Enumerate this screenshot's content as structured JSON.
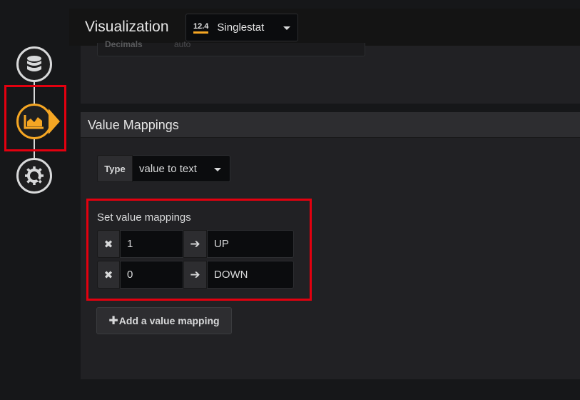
{
  "header": {
    "title": "Visualization",
    "picker_icon_text": "12.4",
    "picker_label": "Singlestat"
  },
  "steps": {
    "datasource_icon": "database-icon",
    "visualization_icon": "chart-area-icon",
    "general_icon": "gear-tools-icon"
  },
  "top_panel": {
    "field_label": "Decimals",
    "field_placeholder": "auto"
  },
  "value_mappings": {
    "title": "Value Mappings",
    "type_label": "Type",
    "type_value": "value to text",
    "set_title": "Set value mappings",
    "rows": [
      {
        "value": "1",
        "text": "UP"
      },
      {
        "value": "0",
        "text": "DOWN"
      }
    ],
    "add_label": "Add a value mapping"
  },
  "colors": {
    "accent": "#f5a623",
    "highlight": "#e3000f",
    "panel": "#212124",
    "background": "#161719"
  }
}
